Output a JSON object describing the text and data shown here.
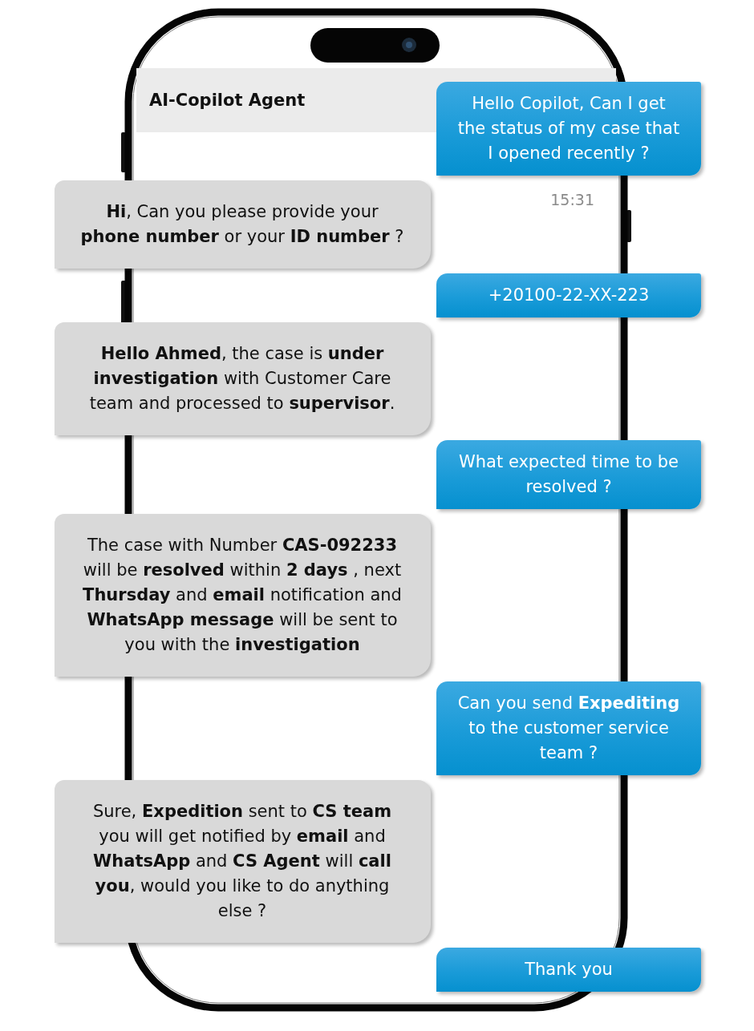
{
  "header": {
    "title": "AI-Copilot Agent"
  },
  "messages": [
    {
      "kind": "sent",
      "text": "Hello Copilot, Can I get the status of my case that I opened recently ?",
      "time": "15:31"
    },
    {
      "kind": "received",
      "text": "**Hi**, Can you please provide your **phone number** or your **ID number** ?"
    },
    {
      "kind": "sent",
      "text": "+20100-22-XX-223"
    },
    {
      "kind": "received",
      "text": "**Hello Ahmed**, the case is **under investigation** with Customer Care team and processed to **supervisor**."
    },
    {
      "kind": "sent",
      "text": "What expected time to be resolved ?"
    },
    {
      "kind": "received",
      "text": "The case with Number **CAS-092233** will be **resolved** within **2 days** , next **Thursday** and **email** notification and **WhatsApp message** will be sent to you with the **investigation**"
    },
    {
      "kind": "sent",
      "text": "Can you send **Expediting** to the customer service team ?"
    },
    {
      "kind": "received",
      "text": "Sure, **Expedition** sent to **CS team** you will get notified by **email** and **WhatsApp** and **CS Agent** will **call you**, would you like to do anything else ?"
    },
    {
      "kind": "sent",
      "text": "Thank you"
    }
  ]
}
